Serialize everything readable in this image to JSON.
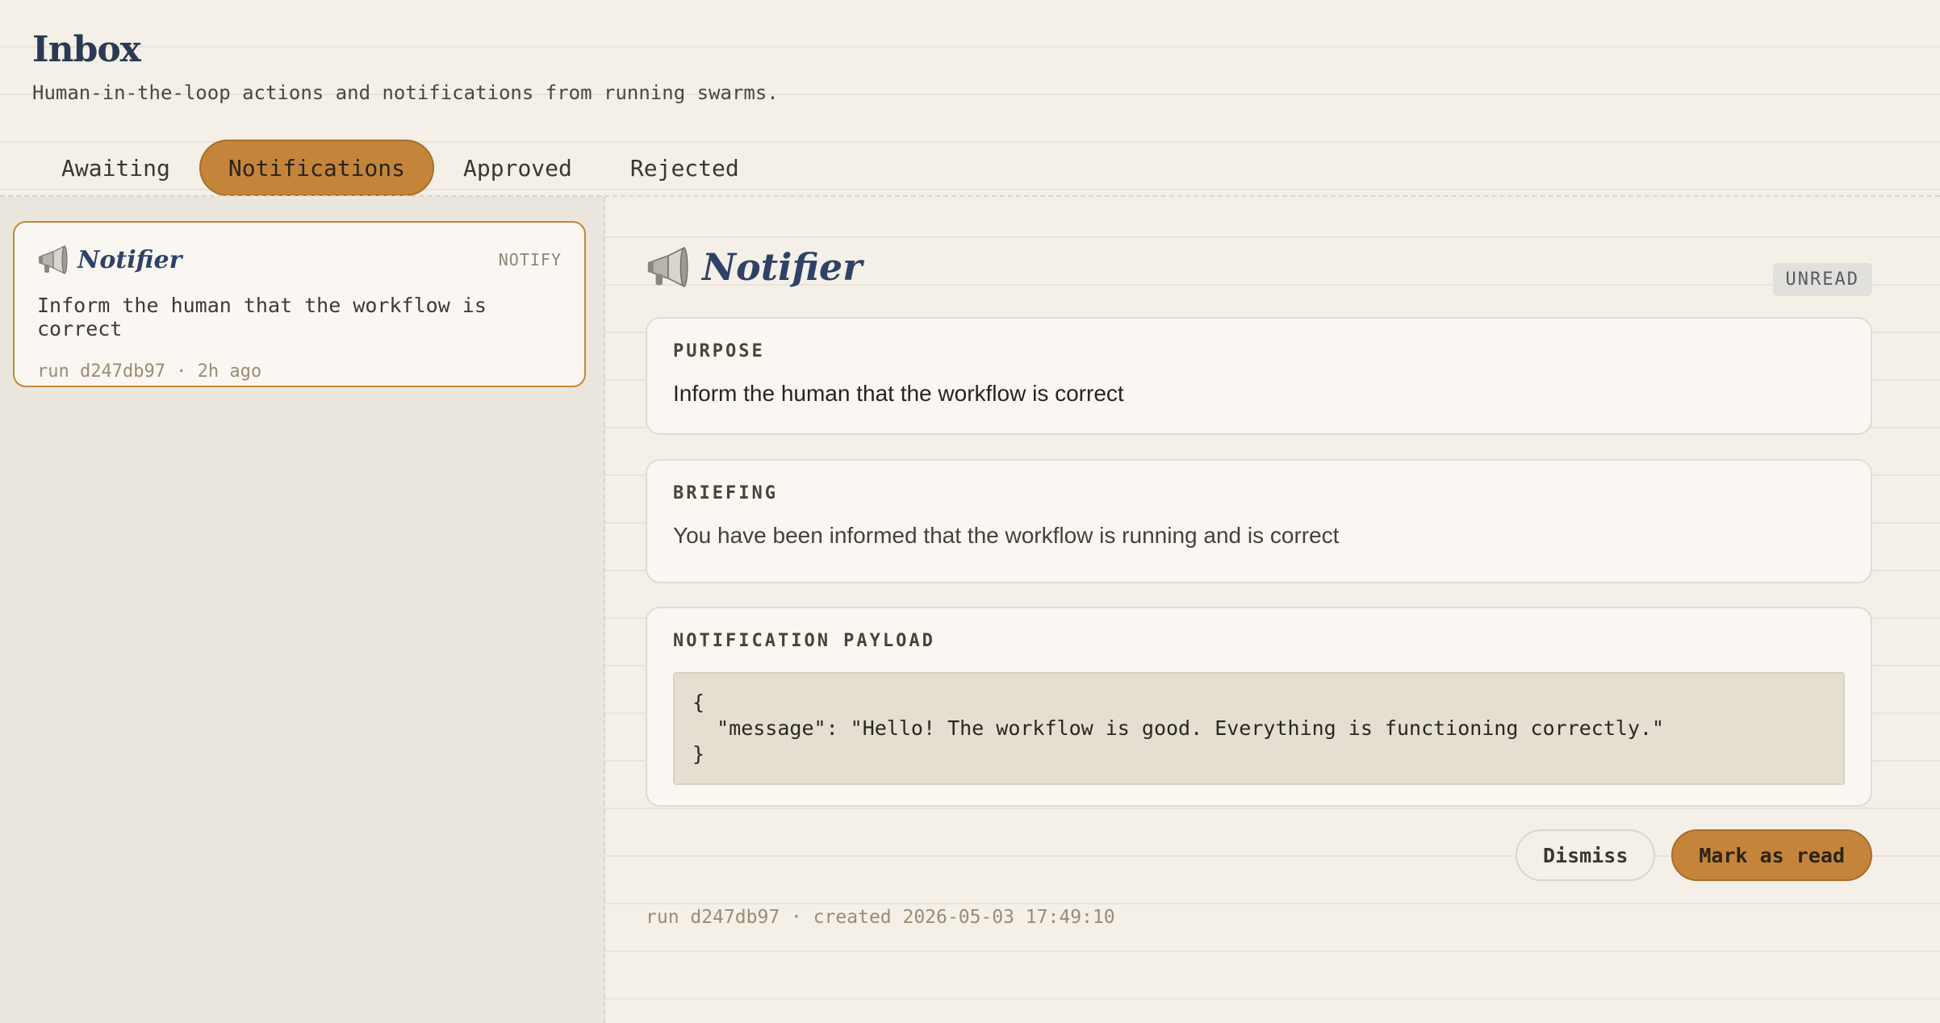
{
  "header": {
    "title": "Inbox",
    "subtitle": "Human-in-the-loop actions and notifications from running swarms."
  },
  "tabs": [
    {
      "label": "Awaiting",
      "active": false
    },
    {
      "label": "Notifications",
      "active": true
    },
    {
      "label": "Approved",
      "active": false
    },
    {
      "label": "Rejected",
      "active": false
    }
  ],
  "list": {
    "items": [
      {
        "icon": "megaphone-icon",
        "agent": "Notifier",
        "kind": "NOTIFY",
        "text": "Inform the human that the workflow is correct",
        "meta": "run d247db97 · 2h ago"
      }
    ]
  },
  "detail": {
    "icon": "megaphone-icon",
    "agent": "Notifier",
    "status": "UNREAD",
    "purpose_label": "PURPOSE",
    "purpose_text": "Inform the human that the workflow is correct",
    "briefing_label": "BRIEFING",
    "briefing_text": "You have been informed that the workflow is running and is correct",
    "payload_label": "NOTIFICATION PAYLOAD",
    "payload_text": "{\n  \"message\": \"Hello! The workflow is good. Everything is functioning correctly.\"\n}",
    "dismiss_label": "Dismiss",
    "mark_read_label": "Mark as read",
    "footer": "run d247db97 · created 2026-05-03 17:49:10"
  },
  "colors": {
    "accent": "#c4853b",
    "background": "#f4f0e8",
    "title": "#2a3a55"
  }
}
